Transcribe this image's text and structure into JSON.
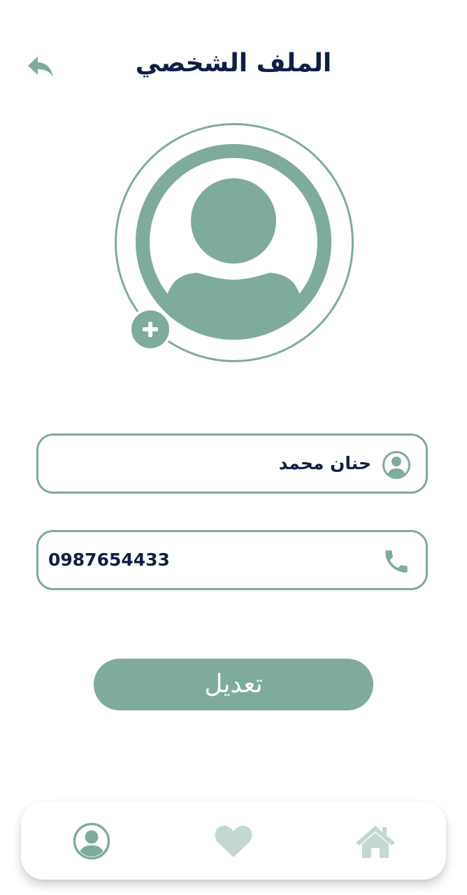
{
  "header": {
    "title": "الملف الشخصي",
    "back_icon": "reply-arrow-icon"
  },
  "avatar": {
    "icon": "user-avatar-icon",
    "add_icon": "plus-icon"
  },
  "form": {
    "name": {
      "icon": "user-circle-icon",
      "value": "حنان محمد"
    },
    "phone": {
      "icon": "phone-icon",
      "value": "0987654433"
    }
  },
  "actions": {
    "edit_label": "تعديل"
  },
  "bottom_nav": {
    "items": [
      {
        "name": "profile",
        "icon": "user-circle-icon",
        "active": true
      },
      {
        "name": "favorites",
        "icon": "heart-icon",
        "active": false
      },
      {
        "name": "home",
        "icon": "home-icon",
        "active": false
      }
    ]
  },
  "colors": {
    "accent": "#7fab9b",
    "accent_light": "#c4d8d0",
    "title_text": "#0f1f44",
    "background": "#ffffff"
  }
}
